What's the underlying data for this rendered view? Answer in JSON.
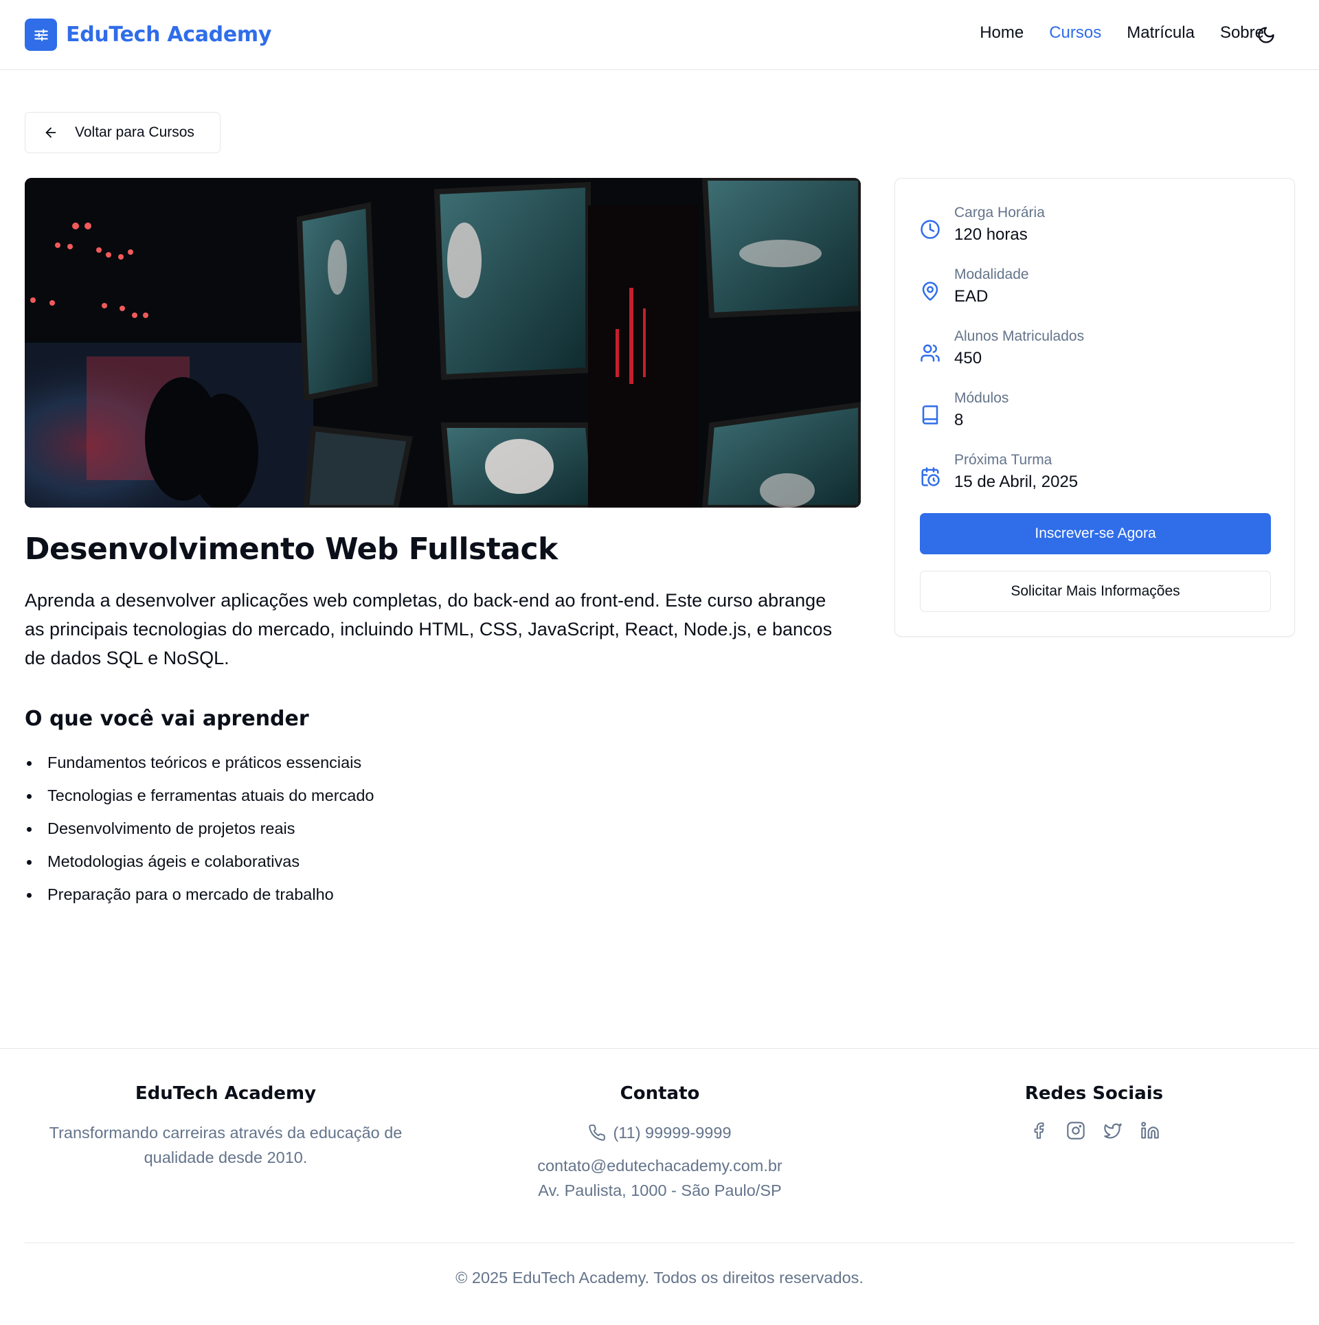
{
  "brand": {
    "name": "EduTech Academy",
    "icon": "sliders-icon",
    "color": "#2f6de9"
  },
  "nav": {
    "items": [
      {
        "label": "Home",
        "active": false
      },
      {
        "label": "Cursos",
        "active": true
      },
      {
        "label": "Matrícula",
        "active": false
      },
      {
        "label": "Sobre",
        "active": false
      }
    ],
    "theme_icon": "moon-icon"
  },
  "back_button": {
    "label": "Voltar para Cursos",
    "icon": "arrow-left-icon"
  },
  "course": {
    "title": "Desenvolvimento Web Fullstack",
    "description": "Aprenda a desenvolver aplicações web completas, do back-end ao front-end. Este curso abrange as principais tecnologias do mercado, incluindo HTML, CSS, JavaScript, React, Node.js, e bancos de dados SQL e NoSQL.",
    "learn_title": "O que você vai aprender",
    "learn_items": [
      "Fundamentos teóricos e práticos essenciais",
      "Tecnologias e ferramentas atuais do mercado",
      "Desenvolvimento de projetos reais",
      "Metodologias ágeis e colaborativas",
      "Preparação para o mercado de trabalho"
    ]
  },
  "info": [
    {
      "label": "Carga Horária",
      "value": "120 horas",
      "icon": "clock-icon"
    },
    {
      "label": "Modalidade",
      "value": "EAD",
      "icon": "map-pin-icon"
    },
    {
      "label": "Alunos Matriculados",
      "value": "450",
      "icon": "users-icon"
    },
    {
      "label": "Módulos",
      "value": "8",
      "icon": "book-icon"
    },
    {
      "label": "Próxima Turma",
      "value": "15 de Abril, 2025",
      "icon": "calendar-clock-icon"
    }
  ],
  "actions": {
    "enroll": "Inscrever-se Agora",
    "more_info": "Solicitar Mais Informações"
  },
  "footer": {
    "about": {
      "title": "EduTech Academy",
      "text": "Transformando carreiras através da educação de qualidade desde 2010."
    },
    "contact": {
      "title": "Contato",
      "phone": "(11) 99999-9999",
      "email": "contato@edutechacademy.com.br",
      "address": "Av. Paulista, 1000 - São Paulo/SP"
    },
    "social": {
      "title": "Redes Sociais",
      "icons": [
        "facebook-icon",
        "instagram-icon",
        "twitter-icon",
        "linkedin-icon"
      ]
    },
    "copyright": "© 2025 EduTech Academy. Todos os direitos reservados."
  }
}
